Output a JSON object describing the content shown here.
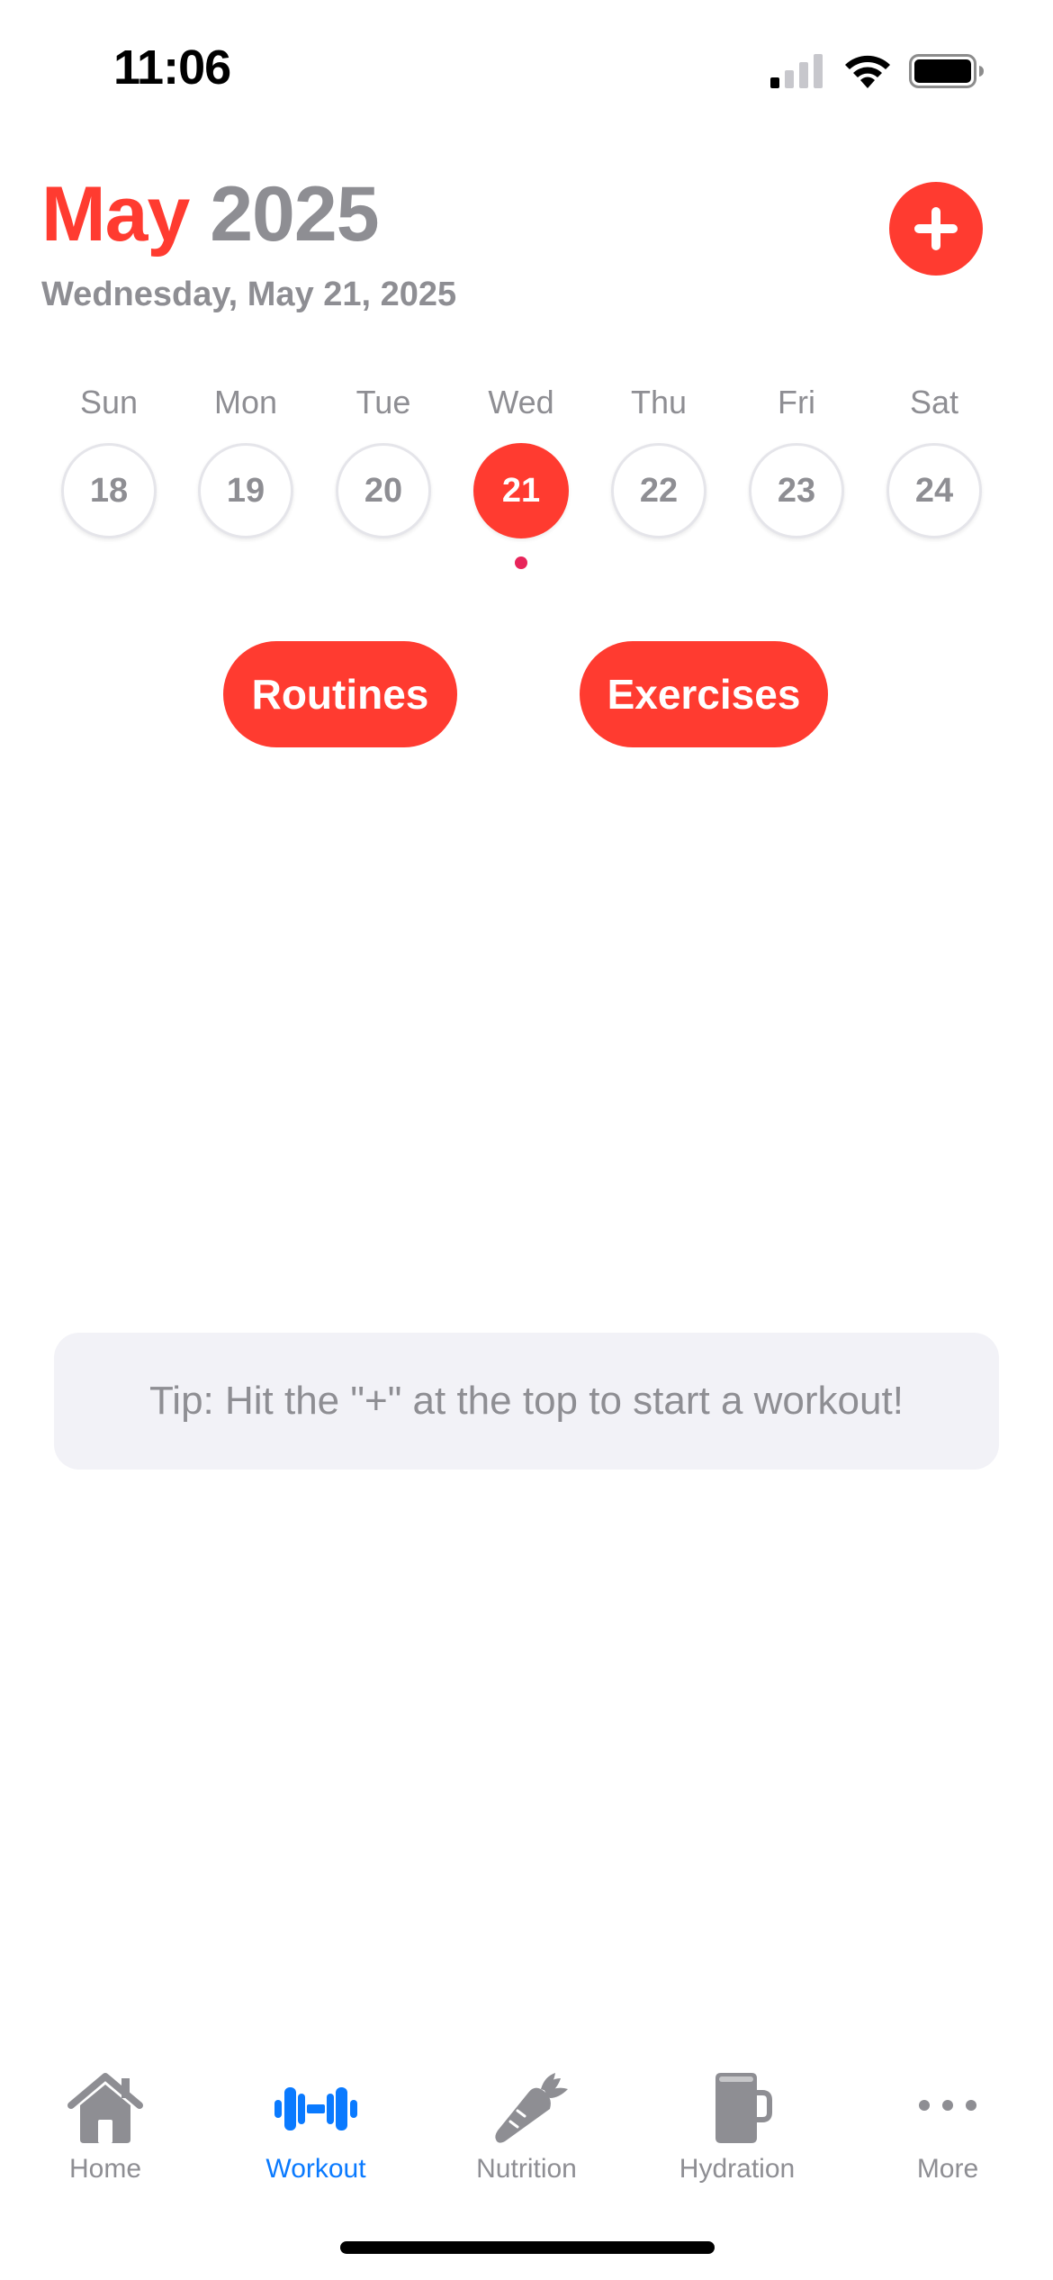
{
  "status_bar": {
    "time": "11:06",
    "icons": [
      "cellular-signal-icon",
      "wifi-icon",
      "battery-icon"
    ]
  },
  "header": {
    "month": "May",
    "year": "2025",
    "full_date": "Wednesday, May 21, 2025",
    "add_icon": "plus-icon"
  },
  "week": {
    "days": [
      {
        "name": "Sun",
        "number": "18"
      },
      {
        "name": "Mon",
        "number": "19"
      },
      {
        "name": "Tue",
        "number": "20"
      },
      {
        "name": "Wed",
        "number": "21",
        "selected": true
      },
      {
        "name": "Thu",
        "number": "22"
      },
      {
        "name": "Fri",
        "number": "23"
      },
      {
        "name": "Sat",
        "number": "24"
      }
    ]
  },
  "actions": {
    "routines_label": "Routines",
    "exercises_label": "Exercises"
  },
  "tip": {
    "text": "Tip: Hit the \"+\" at the top to start a workout!"
  },
  "tab_bar": {
    "tabs": [
      {
        "label": "Home",
        "icon": "house-icon",
        "active": false
      },
      {
        "label": "Workout",
        "icon": "dumbbell-icon",
        "active": true
      },
      {
        "label": "Nutrition",
        "icon": "carrot-icon",
        "active": false
      },
      {
        "label": "Hydration",
        "icon": "mug-icon",
        "active": false
      },
      {
        "label": "More",
        "icon": "ellipsis-icon",
        "active": false
      }
    ]
  },
  "colors": {
    "accent": "#ff3b30",
    "secondary_text": "#8e8e93",
    "active_tab": "#0a7aff",
    "tip_background": "#f2f2f7",
    "event_dot": "#e8245a"
  }
}
